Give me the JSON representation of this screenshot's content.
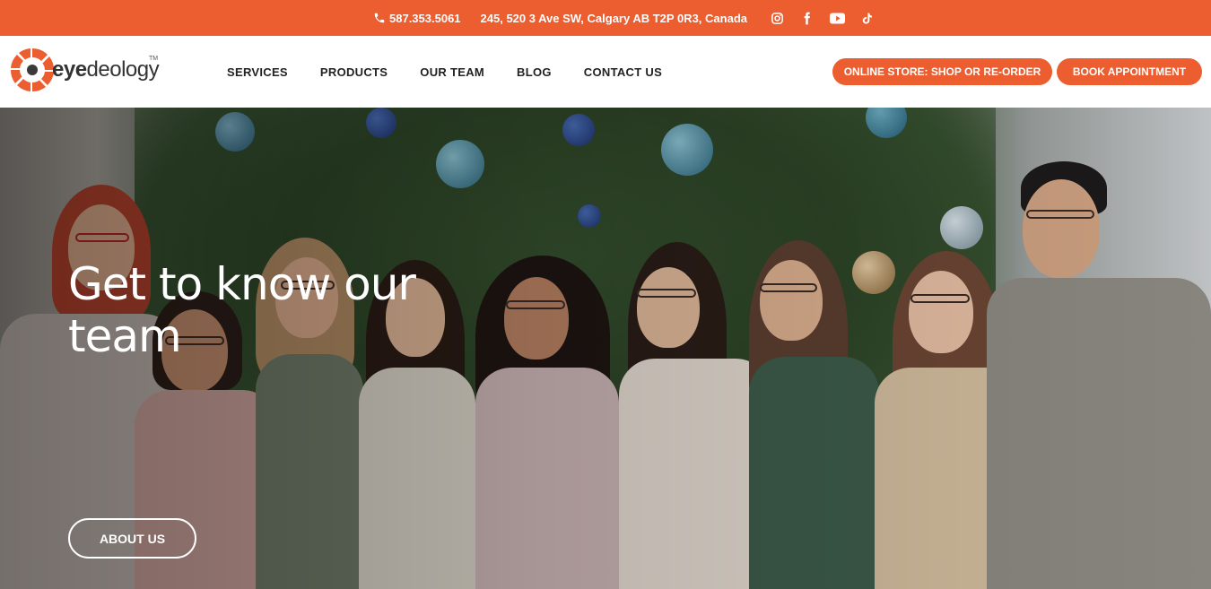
{
  "topbar": {
    "phone": "587.353.5061",
    "address": "245, 520 3 Ave SW, Calgary AB T2P 0R3, Canada",
    "socials": [
      "instagram-icon",
      "facebook-icon",
      "youtube-icon",
      "tiktok-icon"
    ]
  },
  "header": {
    "logo_prefix": "eye",
    "logo_suffix": "deology",
    "logo_tm": "TM",
    "nav": [
      "SERVICES",
      "PRODUCTS",
      "OUR TEAM",
      "BLOG",
      "CONTACT US"
    ],
    "store_button": "ONLINE STORE: SHOP OR RE-ORDER",
    "book_button": "BOOK APPOINTMENT"
  },
  "hero": {
    "title": "Get to know our team",
    "button": "ABOUT US"
  },
  "colors": {
    "accent": "#ec5d2f",
    "text_dark": "#222222",
    "white": "#ffffff"
  }
}
